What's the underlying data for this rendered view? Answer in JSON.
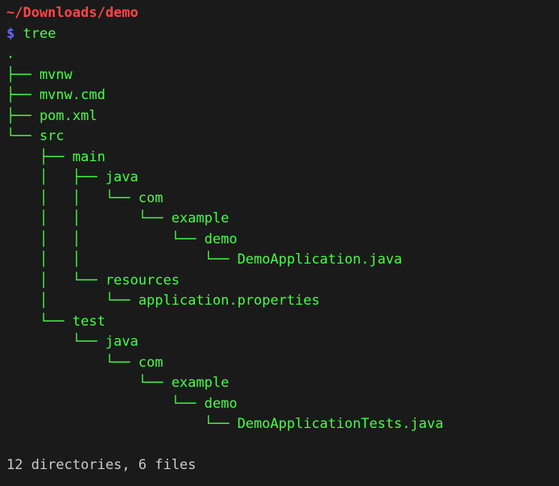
{
  "cwd": "~/Downloads/demo",
  "prompt_symbol": "$",
  "command": "tree",
  "tree_lines": [
    ".",
    "├── mvnw",
    "├── mvnw.cmd",
    "├── pom.xml",
    "└── src",
    "    ├── main",
    "    │   ├── java",
    "    │   │   └── com",
    "    │   │       └── example",
    "    │   │           └── demo",
    "    │   │               └── DemoApplication.java",
    "    │   └── resources",
    "    │       └── application.properties",
    "    └── test",
    "        └── java",
    "            └── com",
    "                └── example",
    "                    └── demo",
    "                        └── DemoApplicationTests.java"
  ],
  "summary": "12 directories, 6 files"
}
